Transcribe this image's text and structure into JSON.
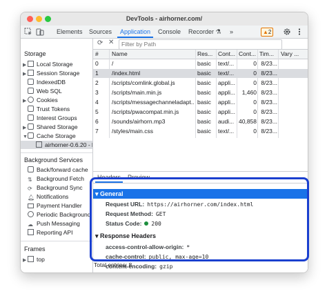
{
  "window": {
    "title": "DevTools - airhorner.com/"
  },
  "toolbar": {
    "tabs": [
      "Elements",
      "Sources",
      "Application",
      "Console",
      "Recorder"
    ],
    "active_tab": "Application",
    "more": "»",
    "warning_count": "2"
  },
  "sidebar": {
    "storage_heading": "Storage",
    "storage_items": [
      "Local Storage",
      "Session Storage",
      "IndexedDB",
      "Web SQL",
      "Cookies",
      "Trust Tokens",
      "Interest Groups",
      "Shared Storage",
      "Cache Storage",
      "airhorner-0.6.20 - ht"
    ],
    "bg_heading": "Background Services",
    "bg_items": [
      "Back/forward cache",
      "Background Fetch",
      "Background Sync",
      "Notifications",
      "Payment Handler",
      "Periodic Background",
      "Push Messaging",
      "Reporting API"
    ],
    "frames_heading": "Frames",
    "frames_items": [
      "top"
    ]
  },
  "filter": {
    "placeholder": "Filter by Path"
  },
  "table": {
    "headers": [
      "#",
      "Name",
      "Res...",
      "Cont...",
      "Cont...",
      "Tim...",
      "Vary ..."
    ],
    "rows": [
      [
        "0",
        "/",
        "basic",
        "text/...",
        "0",
        "8/23...",
        ""
      ],
      [
        "1",
        "/index.html",
        "basic",
        "text/...",
        "0",
        "8/23...",
        ""
      ],
      [
        "2",
        "/scripts/comlink.global.js",
        "basic",
        "appli...",
        "0",
        "8/23...",
        ""
      ],
      [
        "3",
        "/scripts/main.min.js",
        "basic",
        "appli...",
        "1,460",
        "8/23...",
        ""
      ],
      [
        "4",
        "/scripts/messagechanneladapt...",
        "basic",
        "appli...",
        "0",
        "8/23...",
        ""
      ],
      [
        "5",
        "/scripts/pwacompat.min.js",
        "basic",
        "appli...",
        "0",
        "8/23...",
        ""
      ],
      [
        "6",
        "/sounds/airhorn.mp3",
        "basic",
        "audi...",
        "40,858",
        "8/23...",
        ""
      ],
      [
        "7",
        "/styles/main.css",
        "basic",
        "text/...",
        "0",
        "8/23...",
        ""
      ]
    ],
    "selected_row": 1
  },
  "detail": {
    "tabs": [
      "Headers",
      "Preview"
    ],
    "general_title": "▾ General",
    "request_url_key": "Request URL:",
    "request_url_val": "https://airhorner.com/index.html",
    "method_key": "Request Method:",
    "method_val": "GET",
    "status_key": "Status Code:",
    "status_val": "200",
    "response_title": "▾ Response Headers",
    "h1_key": "access-control-allow-origin:",
    "h1_val": "*",
    "h2_key": "cache-control:",
    "h2_val": "public, max-age=10",
    "h3_key": "content-encoding:",
    "h3_val": "gzip"
  },
  "status": {
    "total": "Total entries: 8"
  },
  "colors": {
    "accent": "#1a73e8",
    "highlight": "#1a3fcf"
  }
}
